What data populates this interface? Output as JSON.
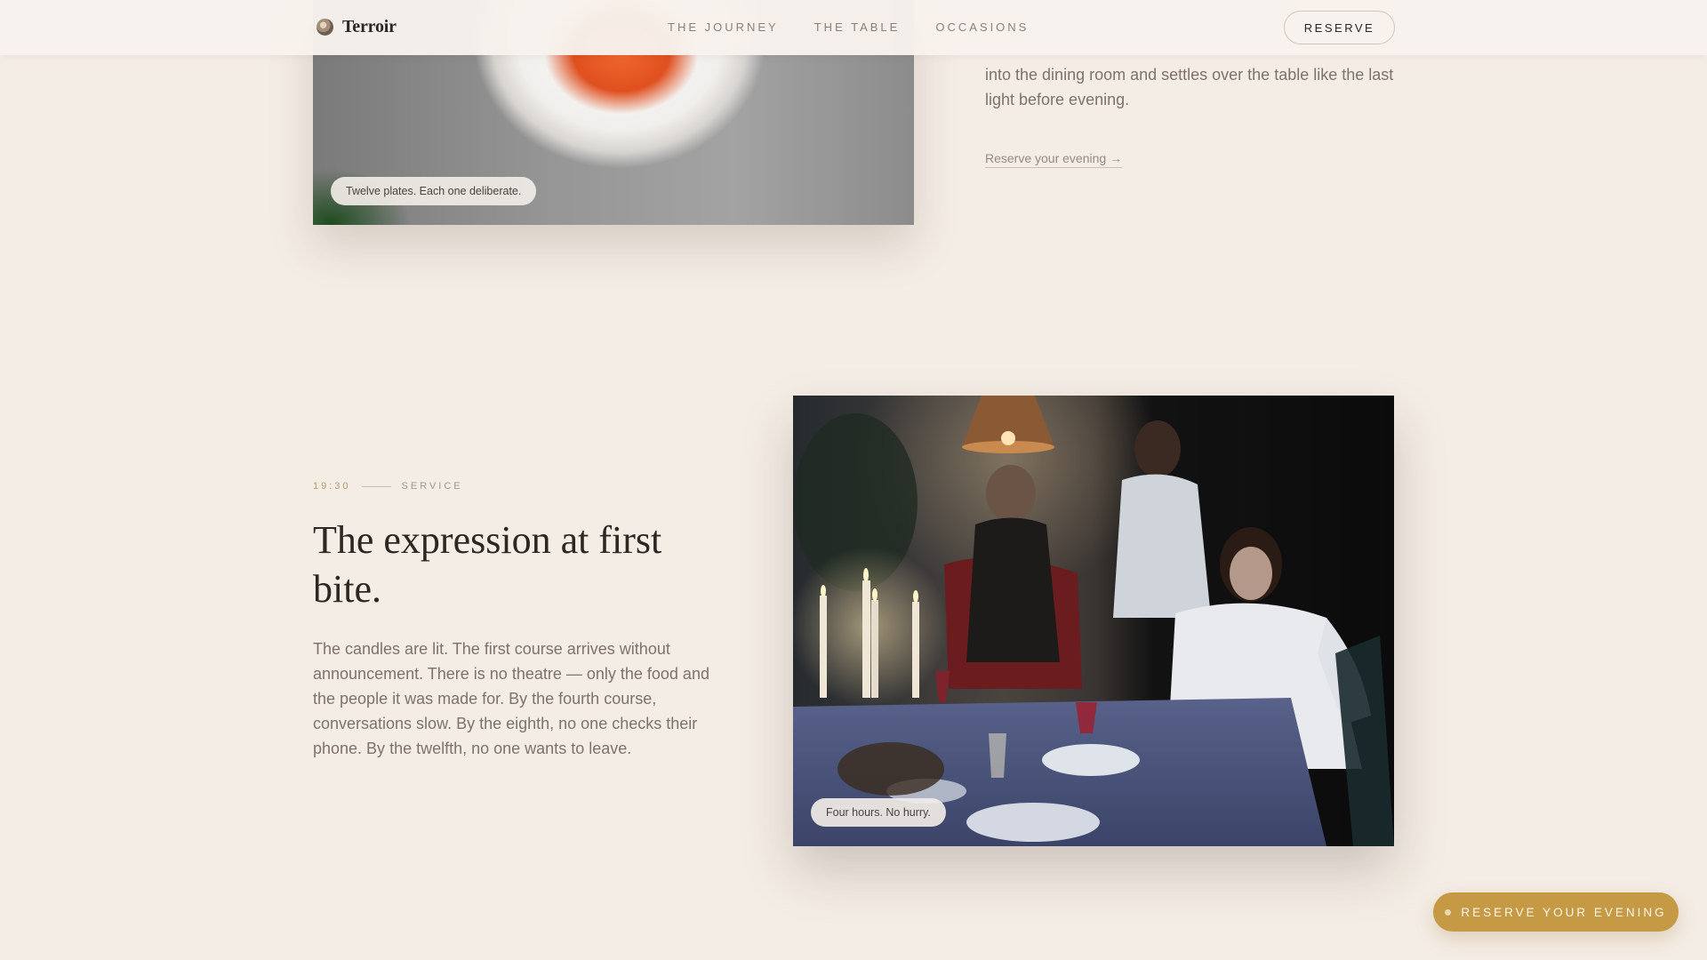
{
  "header": {
    "brand_name": "Terroir",
    "nav": [
      "THE JOURNEY",
      "THE TABLE",
      "OCCASIONS"
    ],
    "reserve_label": "RESERVE"
  },
  "section_prev": {
    "image_caption": "Twelve plates. Each one deliberate.",
    "text_visible": "into the dining room and settles over the table like the last light before evening.",
    "link_label": "Reserve your evening →"
  },
  "section_service": {
    "time": "19:30",
    "label": "SERVICE",
    "title": "The expression at first bite.",
    "body": "The candles are lit. The first course arrives without announcement. There is no theatre — only the food and the people it was made for. By the fourth course, conversations slow. By the eighth, no one checks their phone. By the twelfth, no one wants to leave.",
    "image_caption": "Four hours. No hurry."
  },
  "floating_cta": {
    "label": "RESERVE YOUR EVENING"
  },
  "colors": {
    "background": "#f4ede5",
    "accent_gold": "#c69a44",
    "text_dark": "#2b2723",
    "text_muted": "#7d736b"
  },
  "icons": [
    "brand-logo-icon",
    "dot-icon"
  ]
}
